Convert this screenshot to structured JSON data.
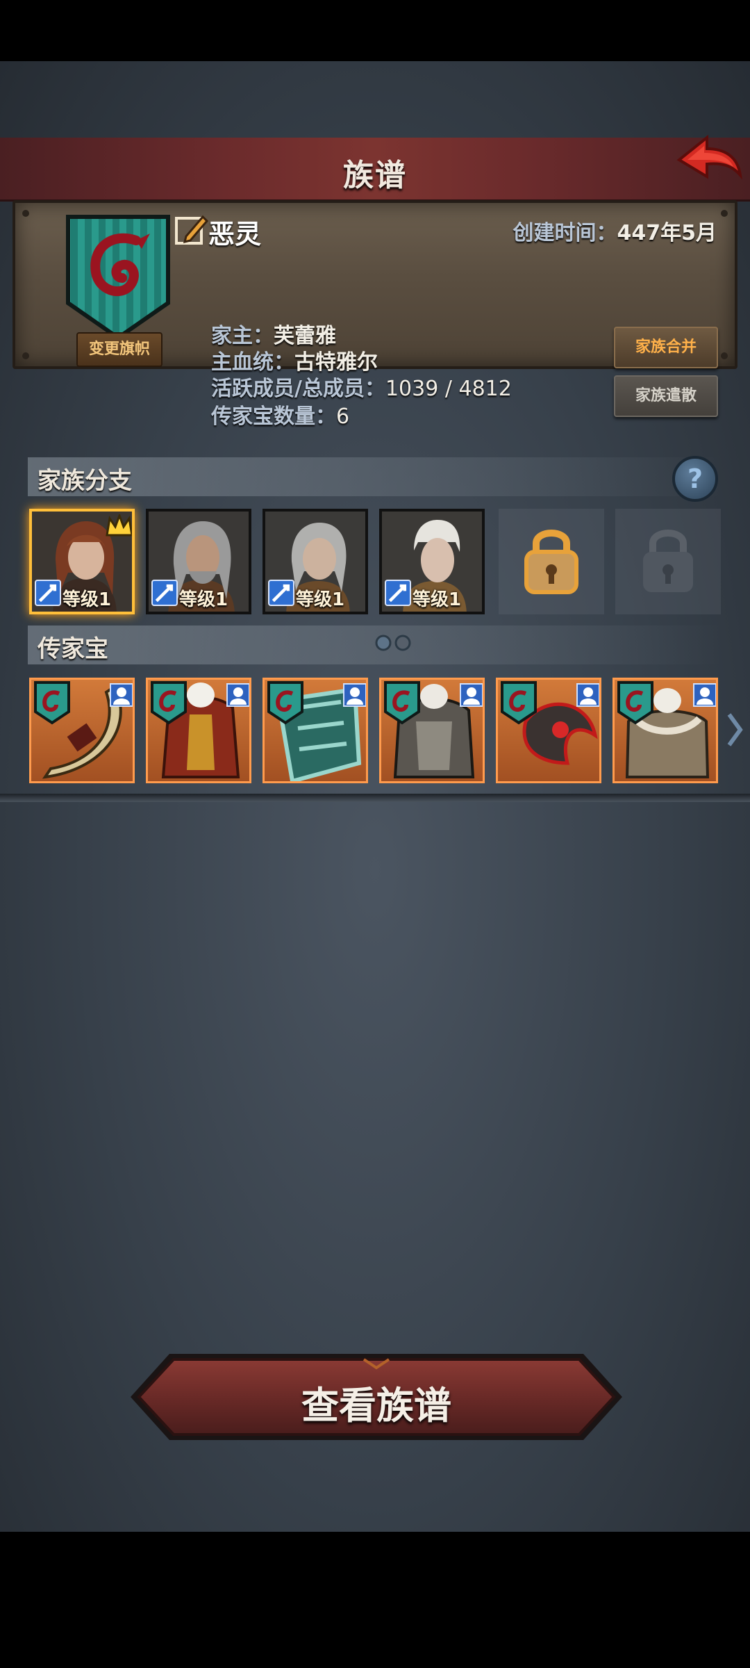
{
  "header": {
    "title": "族谱",
    "back_icon": "back-arrow-icon"
  },
  "family": {
    "name": "恶灵",
    "change_banner_label": "变更旗帜",
    "created_label": "创建时间：",
    "created_value": "447年5月",
    "head_label": "家主：",
    "head_value": "芙蕾雅",
    "bloodline_label": "主血统：",
    "bloodline_value": "古特雅尔",
    "members_label": "活跃成员/总成员：",
    "members_value": "1039 / 4812",
    "heirloom_count_label": "传家宝数量：",
    "heirloom_count_value": "6",
    "merge_button": "家族合并",
    "dissolve_button": "家族遣散"
  },
  "branches": {
    "title": "家族分支",
    "help_label": "?",
    "members": [
      {
        "level": "等级1",
        "leader": true
      },
      {
        "level": "等级1",
        "leader": false
      },
      {
        "level": "等级1",
        "leader": false
      },
      {
        "level": "等级1",
        "leader": false
      }
    ],
    "locked_slots": 2
  },
  "heirlooms": {
    "title": "传家宝",
    "items": [
      {
        "icon": "bow-icon"
      },
      {
        "icon": "armor-icon"
      },
      {
        "icon": "shield-icon"
      },
      {
        "icon": "armor-icon"
      },
      {
        "icon": "axe-icon"
      },
      {
        "icon": "armor-icon"
      }
    ]
  },
  "main_button": {
    "label": "查看族谱"
  },
  "colors": {
    "accent_red": "#7c3430",
    "heirloom_bg": "#d27a3a",
    "gold": "#ffbf3a",
    "banner_teal": "#2a9a8c"
  }
}
